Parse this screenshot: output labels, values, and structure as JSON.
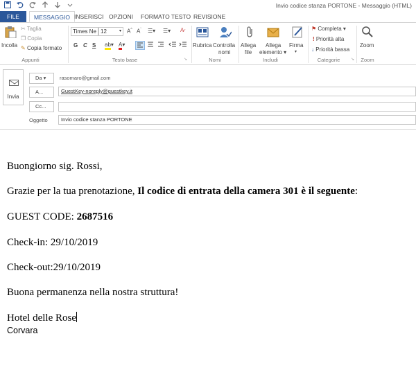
{
  "window": {
    "title": "Invio codice stanza PORTONE - Messaggio (HTML)"
  },
  "quick_access": [
    "save-icon",
    "undo-icon",
    "redo-icon",
    "up-icon",
    "down-icon",
    "customize-icon"
  ],
  "tabs": [
    {
      "label": "FILE"
    },
    {
      "label": "MESSAGGIO"
    },
    {
      "label": "INSERISCI"
    },
    {
      "label": "OPZIONI"
    },
    {
      "label": "FORMATO TESTO"
    },
    {
      "label": "REVISIONE"
    }
  ],
  "ribbon": {
    "clipboard": {
      "paste": "Incolla",
      "cut": "Taglia",
      "copy": "Copia",
      "format_painter": "Copia formato",
      "group": "Appunti"
    },
    "basic_text": {
      "font": "Times Ne",
      "size": "12",
      "bold": "G",
      "italic": "C",
      "underline": "S",
      "group": "Testo base"
    },
    "names": {
      "address_book": "Rubrica",
      "check_names_1": "Controlla",
      "check_names_2": "nomi",
      "group": "Nomi"
    },
    "include": {
      "attach_file_1": "Allega",
      "attach_file_2": "file",
      "attach_item_1": "Allega",
      "attach_item_2": "elemento",
      "signature": "Firma",
      "group": "Includi"
    },
    "tags": {
      "follow_up": "Completa",
      "high": "Priorità alta",
      "low": "Priorità bassa",
      "group": "Categorie"
    },
    "zoom": {
      "zoom": "Zoom",
      "group": "Zoom"
    }
  },
  "header": {
    "send_label": "Invia",
    "from_label": "Da",
    "from_value": "rasomaro@gmail.com",
    "to_label": "A...",
    "to_value": "GuestKey-noreply@guestkey.it",
    "cc_label": "Cc...",
    "cc_value": "",
    "subject_label": "Oggetto",
    "subject_value": "Invio codice stanza PORTONE"
  },
  "message": {
    "greeting": "Buongiorno sig. Rossi,",
    "thanks_plain": "Grazie per la tua prenotazione, ",
    "thanks_bold": "Il codice di entrata della camera 301 è il seguente",
    "thanks_end": ":",
    "guest_code_label": "GUEST CODE: ",
    "guest_code_value": "2687516",
    "checkin": "Check-in: 29/10/2019",
    "checkout": "Check-out:29/10/2019",
    "wish": "Buona permanenza nella nostra struttura!",
    "hotel": "Hotel delle Rose",
    "town": "Corvara"
  }
}
